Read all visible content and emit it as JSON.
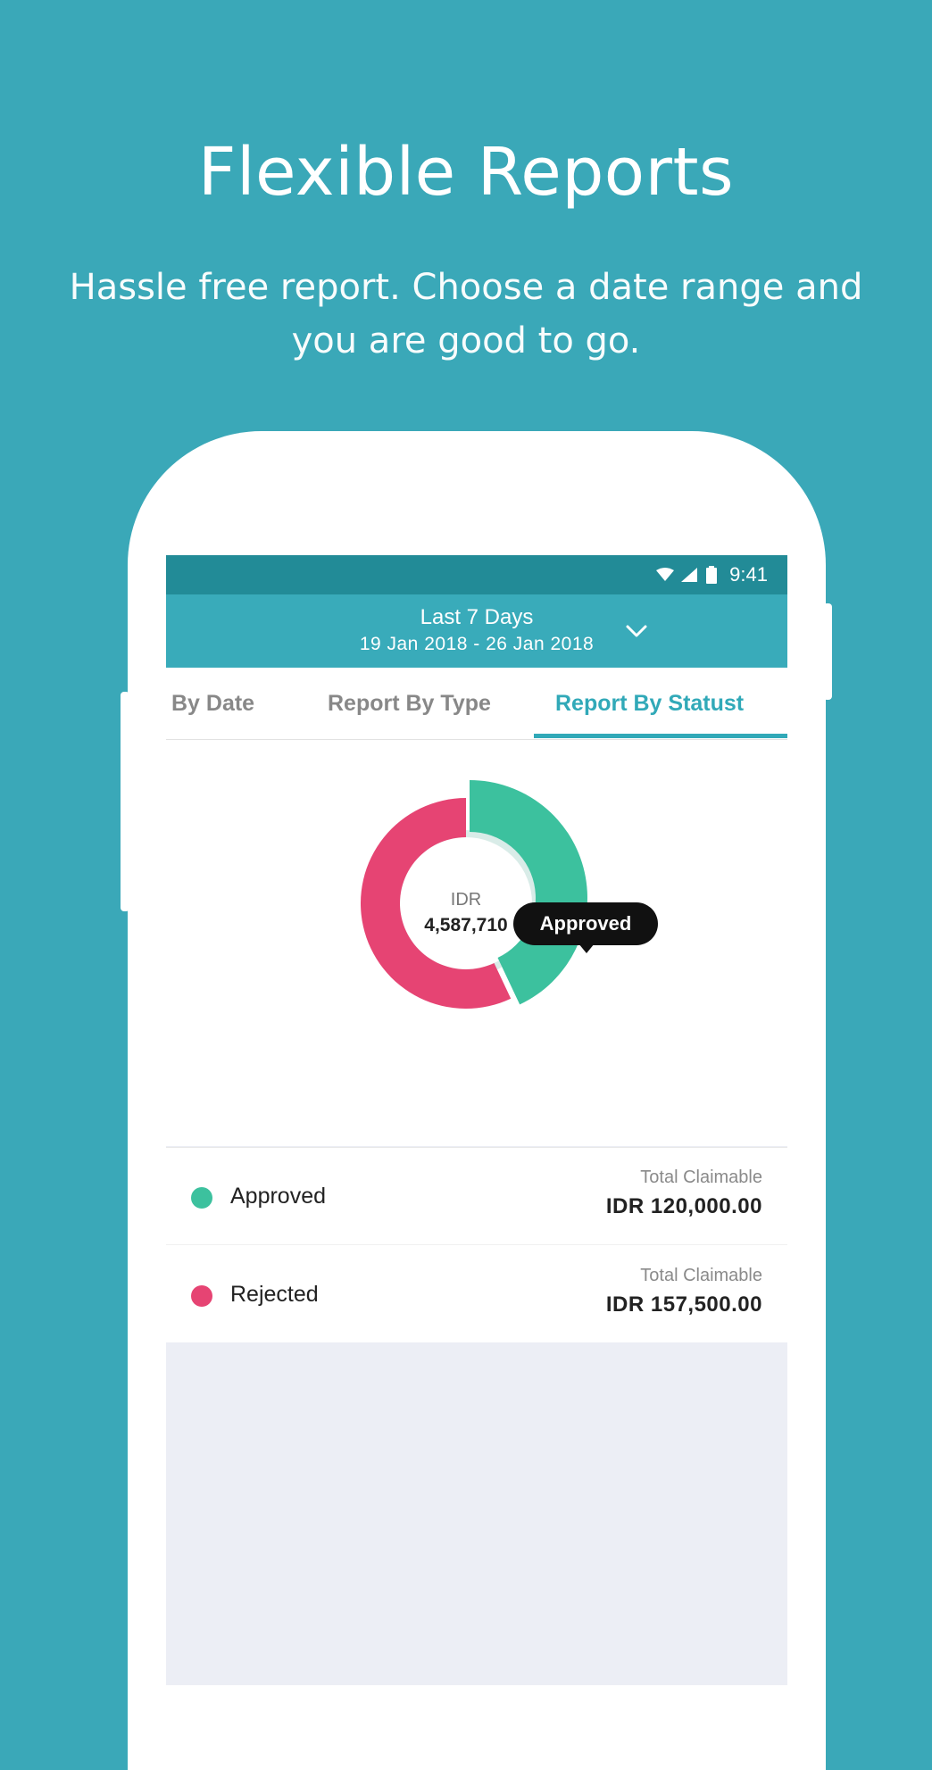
{
  "promo": {
    "title": "Flexible Reports",
    "subtitle": "Hassle free report. Choose a date range and you are good to go."
  },
  "status_bar": {
    "time": "9:41",
    "icons": [
      "wifi-icon",
      "signal-icon",
      "battery-icon"
    ]
  },
  "date_range": {
    "label": "Last 7 Days",
    "dates": "19 Jan 2018 - 26 Jan 2018",
    "icon": "chevron-down-icon"
  },
  "tabs": [
    {
      "label": "By Date",
      "active": false
    },
    {
      "label": "Report By Type",
      "active": false
    },
    {
      "label": "Report By Statust",
      "active": true
    }
  ],
  "chart": {
    "center_label": "IDR",
    "center_value": "4,587,710",
    "tooltip": "Approved"
  },
  "chart_data": {
    "type": "pie",
    "series": [
      {
        "name": "Approved",
        "value": 43,
        "color": "#3cc19e",
        "highlighted": true
      },
      {
        "name": "Rejected",
        "value": 57,
        "color": "#e64473",
        "highlighted": false
      }
    ]
  },
  "legend": [
    {
      "name": "Approved",
      "caption": "Total Claimable",
      "amount": "IDR 120,000.00",
      "color": "#3cc19e"
    },
    {
      "name": "Rejected",
      "caption": "Total Claimable",
      "amount": "IDR 157,500.00",
      "color": "#e64473"
    }
  ],
  "colors": {
    "background": "#3aa8b8",
    "status_bar": "#228b97",
    "header": "#39abba",
    "accent": "#31a9b8"
  }
}
